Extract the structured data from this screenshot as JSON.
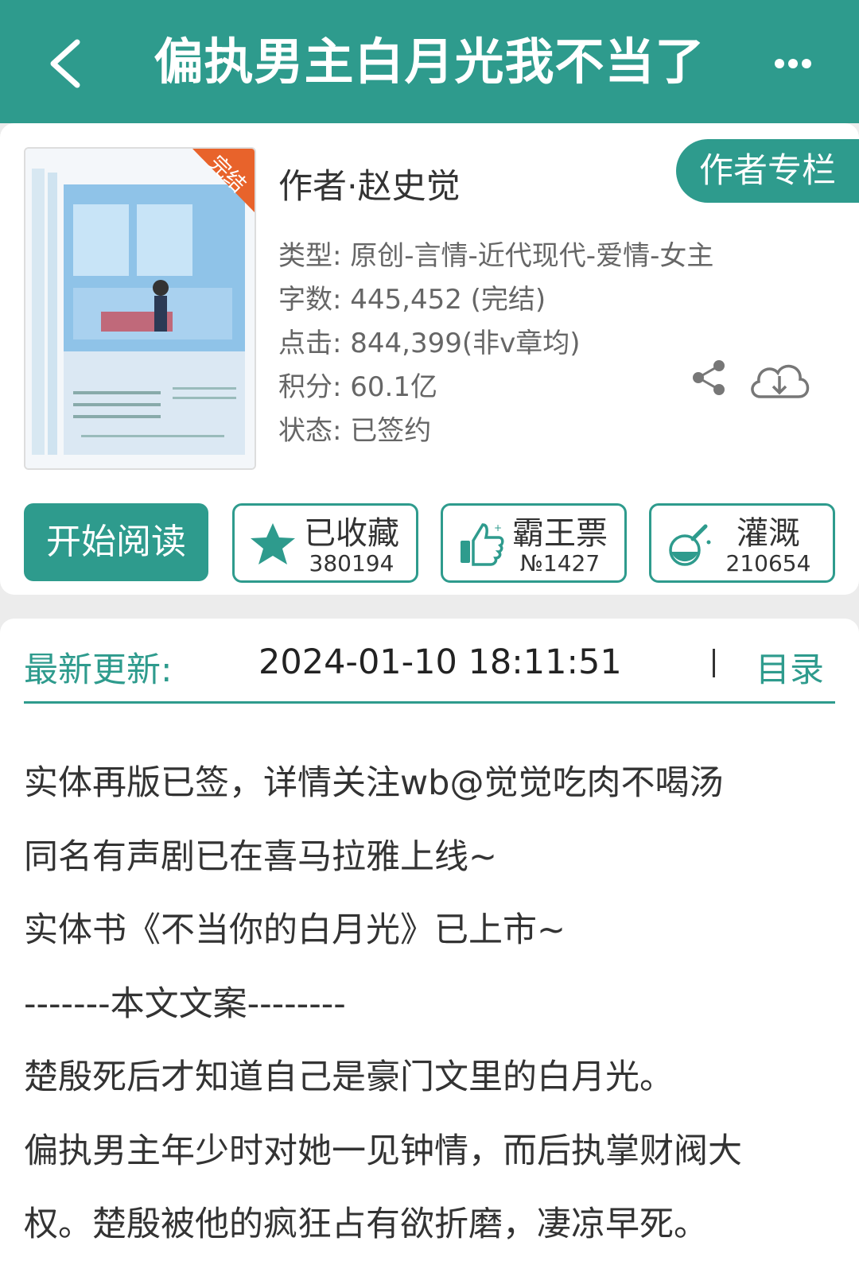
{
  "header": {
    "title": "偏执男主白月光我不当了",
    "back_icon": "chevron-left-icon",
    "more_icon": "more-dots-icon"
  },
  "book": {
    "cover_badge": "完结",
    "author_line": "作者·赵史觉",
    "author_column_label": "作者专栏",
    "meta": {
      "type": "类型: 原创-言情-近代现代-爱情-女主",
      "words": "字数: 445,452 (完结)",
      "clicks": "点击: 844,399(非v章均)",
      "score": "积分: 60.1亿",
      "status": "状态: 已签约"
    }
  },
  "actions": {
    "read_label": "开始阅读",
    "favorite": {
      "label": "已收藏",
      "count": "380194",
      "icon": "star-icon"
    },
    "vote": {
      "label": "霸王票",
      "count": "№1427",
      "icon": "thumbs-up-icon"
    },
    "nourish": {
      "label": "灌溉",
      "count": "210654",
      "icon": "flask-icon"
    }
  },
  "update": {
    "label": "最新更新:",
    "time": "2024-01-10 18:11:51",
    "toc_label": "目录"
  },
  "description": [
    "实体再版已签，详情关注wb@觉觉吃肉不喝汤",
    "同名有声剧已在喜马拉雅上线~",
    "实体书《不当你的白月光》已上市~",
    "-------本文文案--------",
    "楚殷死后才知道自己是豪门文里的白月光。",
    "偏执男主年少时对她一见钟情，而后执掌财阀大",
    "权。楚殷被他的疯狂占有欲折磨，凄凉早死。"
  ],
  "colors": {
    "accent": "#2e9b8d",
    "badge": "#e8632b"
  }
}
